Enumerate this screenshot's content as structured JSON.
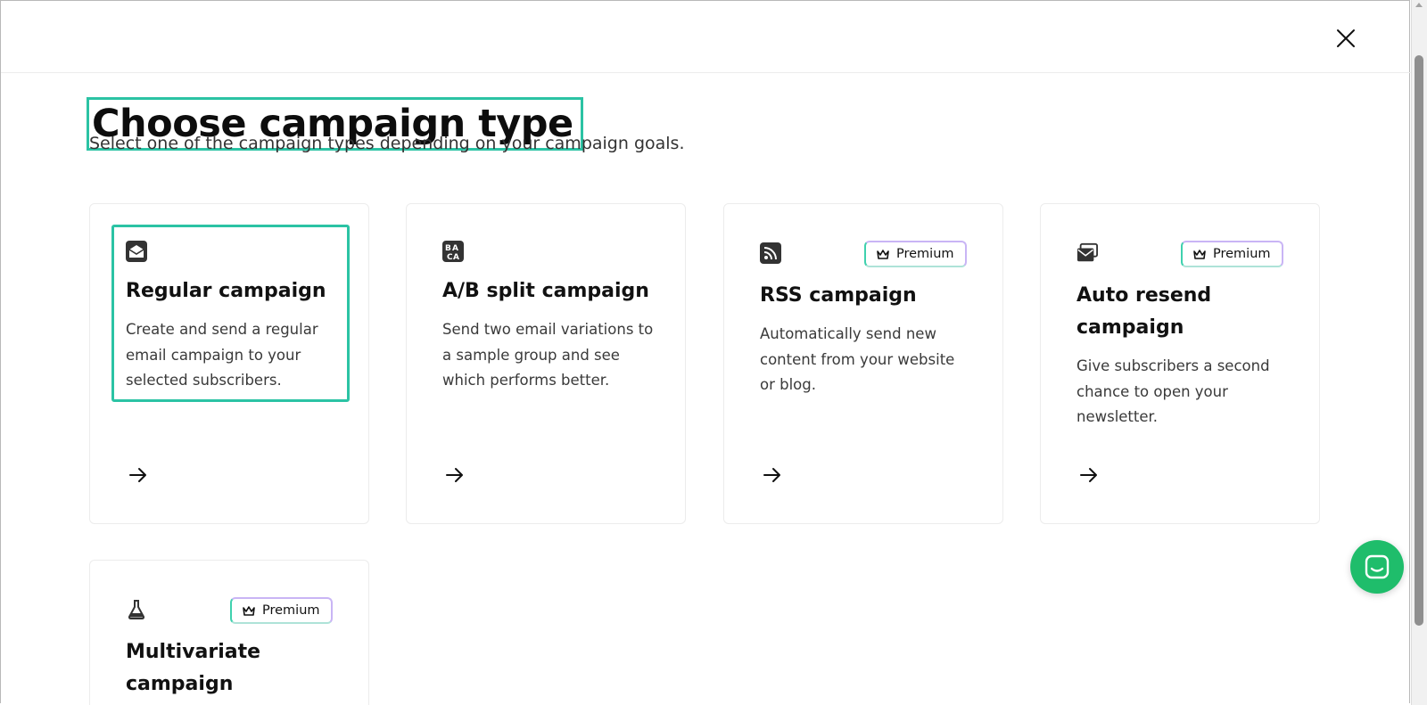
{
  "header": {
    "title": "Choose campaign type",
    "subtitle": "Select one of the campaign types depending on your campaign goals.",
    "close_icon": "close-icon"
  },
  "cards": [
    {
      "icon": "envelope-open-icon",
      "title": "Regular campaign",
      "description": "Create and send a regular email campaign to your selected subscribers.",
      "badge": null,
      "focused": true
    },
    {
      "icon": "ab-split-icon",
      "title": "A/B split campaign",
      "description": "Send two email variations to a sample group and see which performs better.",
      "badge": null,
      "focused": false
    },
    {
      "icon": "rss-icon",
      "title": "RSS campaign",
      "description": "Automatically send new content from your website or blog.",
      "badge": "Premium",
      "focused": false
    },
    {
      "icon": "resend-envelope-icon",
      "title": "Auto resend campaign",
      "description": "Give subscribers a second chance to open your newsletter.",
      "badge": "Premium",
      "focused": false
    },
    {
      "icon": "flask-icon",
      "title": "Multivariate campaign",
      "description": "",
      "badge": "Premium",
      "focused": false
    }
  ],
  "badge_icon": "crown-icon",
  "card_arrow_icon": "arrow-right-icon",
  "chat_launcher_icon": "chat-icon",
  "colors": {
    "accent": "#2bc3a4",
    "chat_green": "#1fbd6b",
    "badge_border": "#c9b5f5"
  }
}
